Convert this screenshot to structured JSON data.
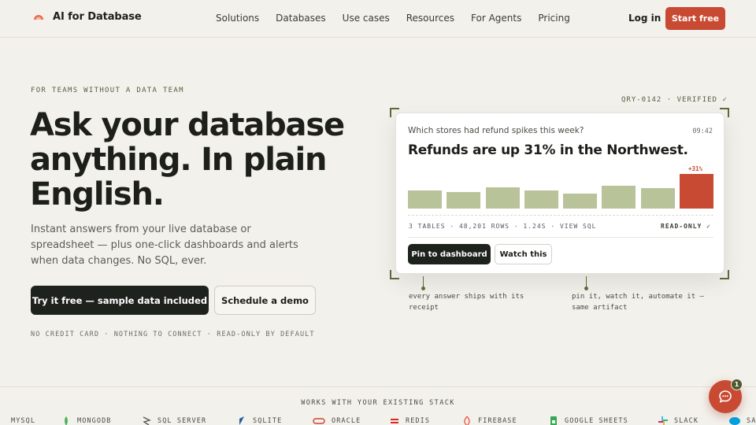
{
  "brand": {
    "name": "AI for Database"
  },
  "nav": {
    "links": [
      "Solutions",
      "Databases",
      "Use cases",
      "Resources",
      "For Agents",
      "Pricing"
    ],
    "login": "Log in",
    "start": "Start free"
  },
  "hero": {
    "eyebrow": "FOR TEAMS WITHOUT A DATA TEAM",
    "headline": "Ask your database anything. In plain English.",
    "subhead": "Instant answers from your live database or spreadsheet — plus one-click dashboards and alerts when data changes. No SQL, ever.",
    "cta_primary": "Try it free — sample data included",
    "cta_secondary": "Schedule a demo",
    "fineprint": "NO CREDIT CARD · NOTHING TO CONNECT · READ-ONLY BY DEFAULT"
  },
  "demo": {
    "query_id": "QRY-0142 · VERIFIED ✓",
    "question": "Which stores had refund spikes this week?",
    "time": "09:42",
    "answer": "Refunds are up 31% in the Northwest.",
    "highlight_label": "+31%",
    "meta": "3 TABLES · 48,201 ROWS · 1.24S · VIEW SQL",
    "readonly": "READ-ONLY ✓",
    "pin_label": "Pin to dashboard",
    "watch_label": "Watch this",
    "note_left": "every answer ships with its receipt",
    "note_right": "pin it, watch it, automate it — same artifact"
  },
  "chart_data": {
    "type": "bar",
    "values": [
      0.53,
      0.47,
      0.62,
      0.53,
      0.43,
      0.66,
      0.58,
      1.0
    ],
    "highlight_index": 7,
    "colors": {
      "base": "#b8c39a",
      "highlight": "#c94a32"
    }
  },
  "stack": {
    "title": "WORKS WITH YOUR EXISTING STACK",
    "items": [
      {
        "label": "MYSQL",
        "icon": "mysql-icon"
      },
      {
        "label": "MONGODB",
        "icon": "mongodb-icon"
      },
      {
        "label": "SQL SERVER",
        "icon": "sql-server-icon"
      },
      {
        "label": "SQLITE",
        "icon": "sqlite-icon"
      },
      {
        "label": "ORACLE",
        "icon": "oracle-icon"
      },
      {
        "label": "REDIS",
        "icon": "redis-icon"
      },
      {
        "label": "FIREBASE",
        "icon": "firebase-icon"
      },
      {
        "label": "GOOGLE SHEETS",
        "icon": "google-sheets-icon"
      },
      {
        "label": "SLACK",
        "icon": "slack-icon"
      },
      {
        "label": "SA",
        "icon": "salesforce-icon"
      }
    ]
  },
  "chat": {
    "badge": "1"
  },
  "colors": {
    "accent": "#c94a32",
    "dark": "#1e221c",
    "olive": "#5d6b3c",
    "background": "#f3f1ec"
  }
}
